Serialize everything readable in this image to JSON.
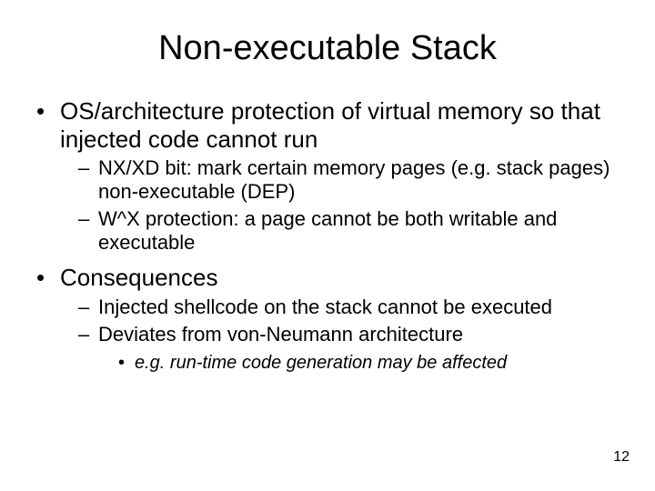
{
  "title": "Non-executable Stack",
  "bullets": [
    {
      "text": "OS/architecture protection of virtual memory so that injected code cannot run",
      "sub": [
        {
          "text": "NX/XD bit: mark certain memory pages (e.g. stack pages) non-executable (DEP)"
        },
        {
          "text": "W^X protection: a page cannot be both writable and executable"
        }
      ]
    },
    {
      "text": "Consequences",
      "sub": [
        {
          "text": "Injected shellcode on the stack cannot be executed"
        },
        {
          "text": "Deviates from von-Neumann architecture",
          "subsub": [
            {
              "text": "e.g. run-time code generation may be affected"
            }
          ]
        }
      ]
    }
  ],
  "page_number": "12"
}
